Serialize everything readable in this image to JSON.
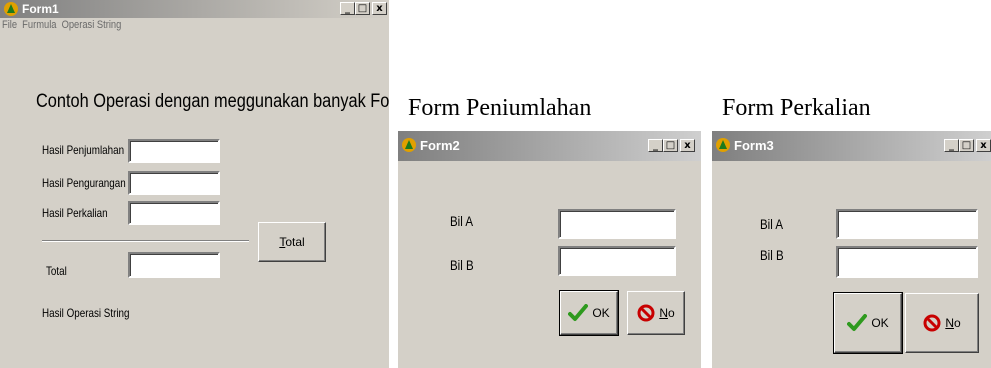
{
  "form1": {
    "title": "Form1",
    "menu": [
      "File",
      "Furmula",
      "Operasi String"
    ],
    "heading": "Contoh Operasi dengan meggunakan banyak Form",
    "labels": {
      "penjumlahan": "Hasil Penjumlahan",
      "pengurangan": "Hasil Pengurangan",
      "perkalian": "Hasil Perkalian",
      "total": "Total",
      "operasi_string": "Hasil Operasi String"
    },
    "total_button": {
      "prefix": "T",
      "rest": "otal"
    },
    "fields": {
      "penjumlahan": "",
      "pengurangan": "",
      "perkalian": "",
      "total": ""
    }
  },
  "captions": {
    "form2": "Form Peniumlahan",
    "form3": "Form Perkalian"
  },
  "form2": {
    "title": "Form2",
    "bil_a": "Bil A",
    "bil_b": "Bil B",
    "fields": {
      "bil_a": "",
      "bil_b": ""
    },
    "ok": "OK",
    "no": {
      "prefix": "N",
      "rest": "o"
    }
  },
  "form3": {
    "title": "Form3",
    "bil_a": "Bil A",
    "bil_b": "Bil B",
    "fields": {
      "bil_a": "",
      "bil_b": ""
    },
    "ok": "OK",
    "no": {
      "prefix": "N",
      "rest": "o"
    }
  },
  "titlebar_buttons": {
    "minimize": "_",
    "maximize": "□",
    "close": "x"
  },
  "colors": {
    "window_face": "#d4d0c8",
    "titlebar_inactive": "#808080",
    "ok_check": "#2e9a1e",
    "no_icon": "#c80000"
  },
  "icons": {
    "app": "app-icon",
    "ok": "checkmark-icon",
    "no": "no-sign-icon"
  }
}
